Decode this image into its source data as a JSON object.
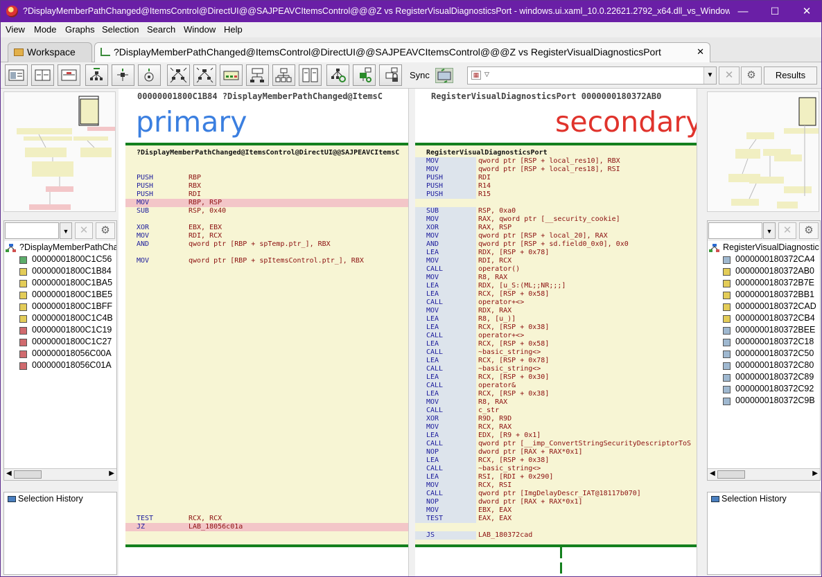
{
  "window": {
    "title": "?DisplayMemberPathChanged@ItemsControl@DirectUI@@SAJPEAVCItemsControl@@@Z vs RegisterVisualDiagnosticsPort - windows.ui.xaml_10.0.22621.2792_x64.dll_vs_Windows.UI.Xaml--...",
    "minimize": "—",
    "maximize": "☐",
    "close": "✕"
  },
  "menu": [
    "View",
    "Mode",
    "Graphs",
    "Selection",
    "Search",
    "Window",
    "Help"
  ],
  "tabs": {
    "workspace": "Workspace",
    "diff": "?DisplayMemberPathChanged@ItemsControl@DirectUI@@SAJPEAVCItemsControl@@@Z vs RegisterVisualDiagnosticsPort",
    "close": "✕"
  },
  "toolbar": {
    "sync_label": "Sync",
    "search_value": "",
    "results_label": "Results",
    "clear_label": "✕",
    "settings_label": "⚙"
  },
  "primary": {
    "header": "00000001800C1B84 ?DisplayMemberPathChanged@ItemsC",
    "label": "primary",
    "label_color": "#3b7fe0",
    "func_name": "?DisplayMemberPathChanged@ItemsControl@DirectUI@@SAJPEAVCItemsC",
    "lines": [
      {
        "m": "",
        "o": ""
      },
      {
        "m": "PUSH",
        "o": "RBP"
      },
      {
        "m": "PUSH",
        "o": "RBX"
      },
      {
        "m": "PUSH",
        "o": "RDI"
      },
      {
        "m": "MOV",
        "o": "RBP, RSP",
        "hl": true
      },
      {
        "m": "SUB",
        "o": "RSP, 0x40"
      },
      {
        "m": "",
        "o": ""
      },
      {
        "m": "XOR",
        "o": "EBX, EBX"
      },
      {
        "m": "MOV",
        "o": "RDI, RCX"
      },
      {
        "m": "AND",
        "o": "qword ptr [RBP + spTemp.ptr_], RBX"
      },
      {
        "m": "",
        "o": ""
      },
      {
        "m": "MOV",
        "o": "qword ptr [RBP + spItemsControl.ptr_], RBX"
      }
    ],
    "tail": [
      {
        "m": "TEST",
        "o": "RCX, RCX"
      },
      {
        "m": "JZ",
        "o": "LAB_18056c01a",
        "hl": true
      }
    ]
  },
  "secondary": {
    "header": "RegisterVisualDiagnosticsPort 0000000180372AB0",
    "label": "secondary",
    "label_color": "#e0332c",
    "func_name": "RegisterVisualDiagnosticsPort",
    "lines": [
      {
        "m": "MOV",
        "o": "qword ptr [RSP + local_res10], RBX",
        "bl": true
      },
      {
        "m": "MOV",
        "o": "qword ptr [RSP + local_res18], RSI",
        "bl": true
      },
      {
        "m": "PUSH",
        "o": "RDI",
        "bl": true
      },
      {
        "m": "PUSH",
        "o": "R14",
        "bl": true
      },
      {
        "m": "PUSH",
        "o": "R15",
        "bl": true
      },
      {
        "m": "",
        "o": ""
      },
      {
        "m": "SUB",
        "o": "RSP, 0xa0",
        "bl": true
      },
      {
        "m": "MOV",
        "o": "RAX, qword ptr [__security_cookie]",
        "bl": true
      },
      {
        "m": "XOR",
        "o": "RAX, RSP",
        "bl": true
      },
      {
        "m": "MOV",
        "o": "qword ptr [RSP + local_20], RAX",
        "bl": true
      },
      {
        "m": "AND",
        "o": "qword ptr [RSP + sd.field0_0x0], 0x0",
        "bl": true
      },
      {
        "m": "LEA",
        "o": "RDX, [RSP + 0x78]",
        "bl": true
      },
      {
        "m": "MOV",
        "o": "RDI, RCX",
        "bl": true
      },
      {
        "m": "CALL",
        "o": "operator()",
        "bl": true
      },
      {
        "m": "MOV",
        "o": "R8, RAX",
        "bl": true
      },
      {
        "m": "LEA",
        "o": "RDX, [u_S:(ML;;NR;;;]",
        "bl": true
      },
      {
        "m": "LEA",
        "o": "RCX, [RSP + 0x58]",
        "bl": true
      },
      {
        "m": "CALL",
        "o": "operator+<>",
        "bl": true
      },
      {
        "m": "MOV",
        "o": "RDX, RAX",
        "bl": true
      },
      {
        "m": "LEA",
        "o": "R8, [u_)]",
        "bl": true
      },
      {
        "m": "LEA",
        "o": "RCX, [RSP + 0x38]",
        "bl": true
      },
      {
        "m": "CALL",
        "o": "operator+<>",
        "bl": true
      },
      {
        "m": "LEA",
        "o": "RCX, [RSP + 0x58]",
        "bl": true
      },
      {
        "m": "CALL",
        "o": "~basic_string<>",
        "bl": true
      },
      {
        "m": "LEA",
        "o": "RCX, [RSP + 0x78]",
        "bl": true
      },
      {
        "m": "CALL",
        "o": "~basic_string<>",
        "bl": true
      },
      {
        "m": "LEA",
        "o": "RCX, [RSP + 0x30]",
        "bl": true
      },
      {
        "m": "CALL",
        "o": "operator&",
        "bl": true
      },
      {
        "m": "LEA",
        "o": "RCX, [RSP + 0x38]",
        "bl": true
      },
      {
        "m": "MOV",
        "o": "R8, RAX",
        "bl": true
      },
      {
        "m": "CALL",
        "o": "c_str",
        "bl": true
      },
      {
        "m": "XOR",
        "o": "R9D, R9D",
        "bl": true
      },
      {
        "m": "MOV",
        "o": "RCX, RAX",
        "bl": true
      },
      {
        "m": "LEA",
        "o": "EDX, [R9 + 0x1]",
        "bl": true
      },
      {
        "m": "CALL",
        "o": "qword ptr [__imp_ConvertStringSecurityDescriptorToS",
        "bl": true
      },
      {
        "m": "NOP",
        "o": "dword ptr [RAX + RAX*0x1]",
        "bl": true
      },
      {
        "m": "LEA",
        "o": "RCX, [RSP + 0x38]",
        "bl": true
      },
      {
        "m": "CALL",
        "o": "~basic_string<>",
        "bl": true
      },
      {
        "m": "LEA",
        "o": "RSI, [RDI + 0x290]",
        "bl": true
      },
      {
        "m": "MOV",
        "o": "RCX, RSI",
        "bl": true
      },
      {
        "m": "CALL",
        "o": "qword ptr [ImgDelayDescr_IAT@18117b070]",
        "bl": true
      },
      {
        "m": "NOP",
        "o": "dword ptr [RAX + RAX*0x1]",
        "bl": true
      },
      {
        "m": "MOV",
        "o": "EBX, EAX",
        "bl": true
      },
      {
        "m": "TEST",
        "o": "EAX, EAX",
        "bl": true
      },
      {
        "m": "",
        "o": ""
      },
      {
        "m": "JS",
        "o": "LAB_180372cad",
        "bl": true
      }
    ]
  },
  "left_tree": {
    "root": "?DisplayMemberPathChanged",
    "items": [
      {
        "label": "00000001800C1C56",
        "color": "#5cad6a"
      },
      {
        "label": "00000001800C1B84",
        "color": "#e3cc58"
      },
      {
        "label": "00000001800C1BA5",
        "color": "#e3cc58"
      },
      {
        "label": "00000001800C1BE5",
        "color": "#e3cc58"
      },
      {
        "label": "00000001800C1BFF",
        "color": "#e3cc58"
      },
      {
        "label": "00000001800C1C4B",
        "color": "#e3cc58"
      },
      {
        "label": "00000001800C1C19",
        "color": "#d06a6e"
      },
      {
        "label": "00000001800C1C27",
        "color": "#d06a6e"
      },
      {
        "label": "000000018056C00A",
        "color": "#d06a6e"
      },
      {
        "label": "000000018056C01A",
        "color": "#d06a6e"
      }
    ]
  },
  "right_tree": {
    "root": "RegisterVisualDiagnostic",
    "items": [
      {
        "label": "0000000180372CA4",
        "color": "#9fb8d0"
      },
      {
        "label": "0000000180372AB0",
        "color": "#e3cc58"
      },
      {
        "label": "0000000180372B7E",
        "color": "#e3cc58"
      },
      {
        "label": "0000000180372BB1",
        "color": "#e3cc58"
      },
      {
        "label": "0000000180372CAD",
        "color": "#e3cc58"
      },
      {
        "label": "0000000180372CB4",
        "color": "#e3cc58"
      },
      {
        "label": "0000000180372BEE",
        "color": "#9fb8d0"
      },
      {
        "label": "0000000180372C18",
        "color": "#9fb8d0"
      },
      {
        "label": "0000000180372C50",
        "color": "#9fb8d0"
      },
      {
        "label": "0000000180372C80",
        "color": "#9fb8d0"
      },
      {
        "label": "0000000180372C89",
        "color": "#9fb8d0"
      },
      {
        "label": "0000000180372C92",
        "color": "#9fb8d0"
      },
      {
        "label": "0000000180372C9B",
        "color": "#9fb8d0"
      }
    ]
  },
  "history": {
    "label": "Selection History"
  }
}
